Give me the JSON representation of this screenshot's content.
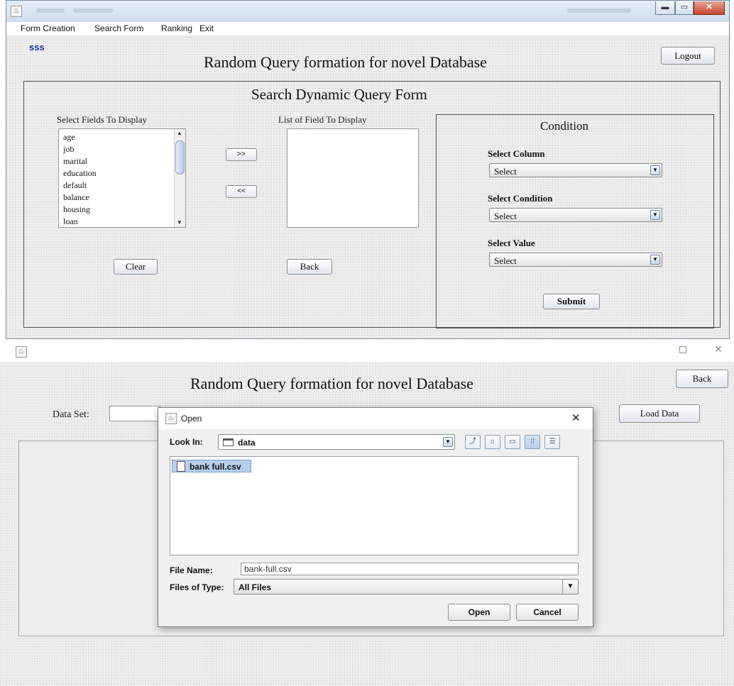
{
  "top_window": {
    "menu": [
      "Form Creation",
      "Search Form",
      "Ranking",
      "Exit"
    ],
    "user": "sss",
    "title": "Random Query formation for novel Database",
    "logout_label": "Logout",
    "form_title": "Search Dynamic Query Form",
    "select_fields_label": "Select Fields To Display",
    "fields": [
      "age",
      "job",
      "marital",
      "education",
      "default",
      "balance",
      "housing",
      "loan"
    ],
    "list_label": "List of Field To Display",
    "add_label": ">>",
    "remove_label": "<<",
    "clear_label": "Clear",
    "back_label": "Back",
    "condition": {
      "title": "Condition",
      "column_label": "Select Column",
      "column_value": "Select",
      "condition_label": "Select Condition",
      "condition_value": "Select",
      "value_label": "Select Value",
      "value_value": "Select",
      "submit_label": "Submit"
    }
  },
  "bottom_window": {
    "title": "Random Query formation for novel Database",
    "back_label": "Back",
    "data_set_label": "Data Set:",
    "load_label": "Load Data"
  },
  "open_dialog": {
    "title": "Open",
    "look_in_label": "Look In:",
    "look_in_value": "data",
    "file": "bank full.csv",
    "file_name_label": "File Name:",
    "file_name_value": "bank-full.csv",
    "files_type_label": "Files of Type:",
    "files_type_value": "All Files",
    "open_label": "Open",
    "cancel_label": "Cancel"
  },
  "colors": {
    "user_text": "#1a2ea0",
    "selected_file": "#b8d0ef",
    "window_frame": "#7a8aa0"
  },
  "icons": [
    "java-app-icon",
    "minimize-icon",
    "maximize-icon",
    "close-icon",
    "folder-icon",
    "file-icon",
    "up-folder-icon",
    "home-icon",
    "new-folder-icon",
    "list-view-icon",
    "details-view-icon",
    "chevron-down-icon"
  ]
}
